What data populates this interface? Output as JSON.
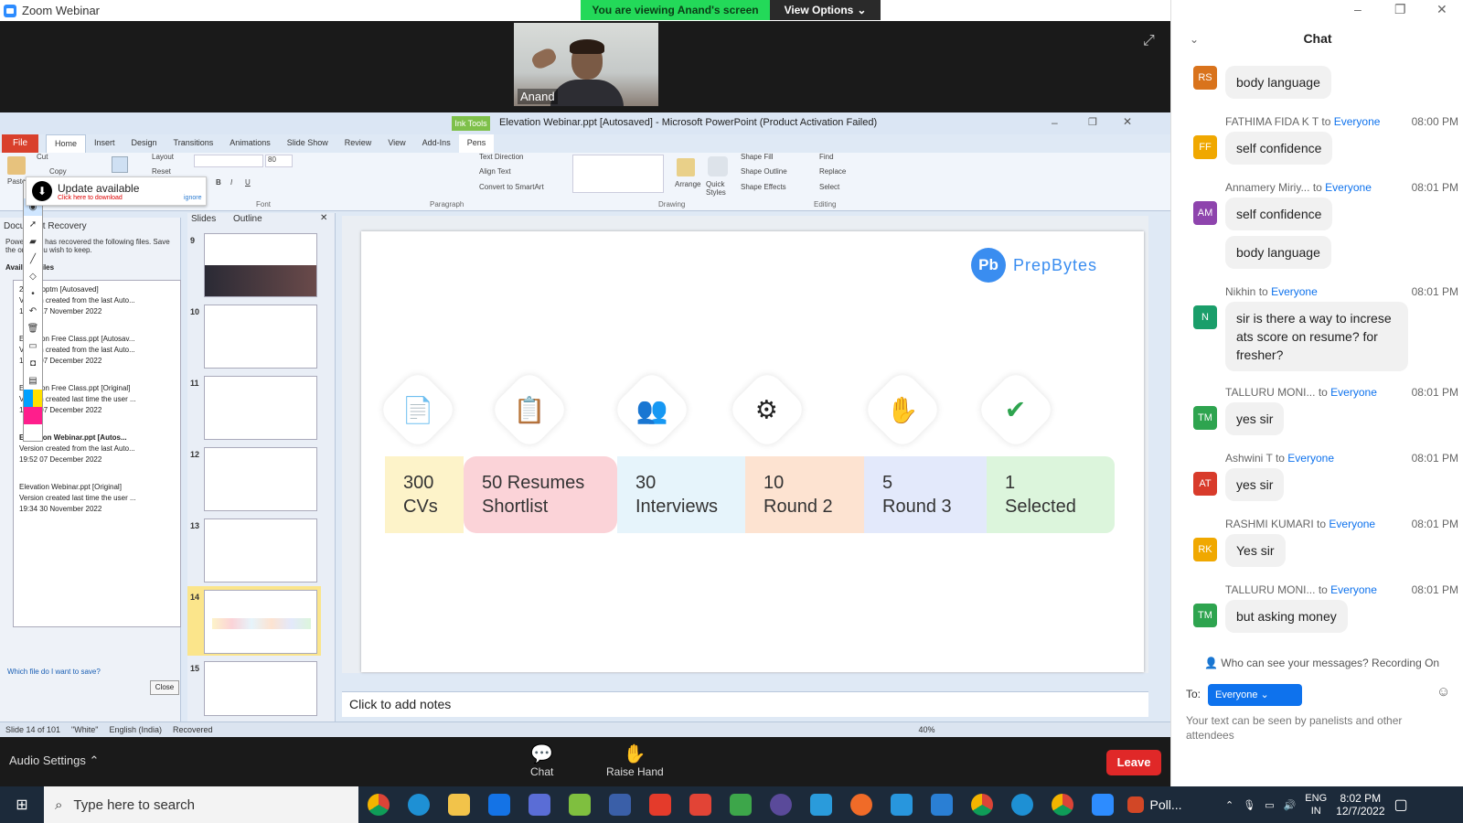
{
  "zoom": {
    "window_title": "Zoom Webinar",
    "viewing_banner": "You are viewing Anand's screen",
    "view_options": "View Options",
    "video_name": "Anand"
  },
  "ppt": {
    "title": "Elevation Webinar.ppt [Autosaved] - Microsoft PowerPoint (Product Activation Failed)",
    "ink_tools": "Ink Tools",
    "pens": "Pens",
    "file_tab": "File",
    "tabs": [
      "Home",
      "Insert",
      "Design",
      "Transitions",
      "Animations",
      "Slide Show",
      "Review",
      "View",
      "Add-Ins"
    ],
    "ribbon": {
      "cut": "Cut",
      "copy": "Copy",
      "paste": "Paste",
      "layout": "Layout",
      "reset": "Reset",
      "font": "Font",
      "paragraph": "Paragraph",
      "drawing": "Drawing",
      "editing": "Editing",
      "text_direction": "Text Direction",
      "align_text": "Align Text",
      "convert_smartart": "Convert to SmartArt",
      "arrange": "Arrange",
      "quick_styles": "Quick Styles",
      "shape_fill": "Shape Fill",
      "shape_outline": "Shape Outline",
      "shape_effects": "Shape Effects",
      "find": "Find",
      "replace": "Replace",
      "select": "Select",
      "font_size": "80"
    },
    "update": {
      "title": "Update available",
      "sub": "Click here to download",
      "ignore": "ignore"
    },
    "recovery": {
      "header": "Document Recovery",
      "desc": "PowerPoint has recovered the following files. Save the ones you wish to keep.",
      "available": "Available files",
      "items": [
        {
          "name": "29433.pptm  [Autosaved]",
          "line1": "Version created from the last Auto...",
          "line2": "19:59 17 November 2022"
        },
        {
          "name": "Elevation Free Class.ppt  [Autosav...",
          "line1": "Version created from the last Auto...",
          "line2": "19:23 07 December 2022"
        },
        {
          "name": "Elevation Free Class.ppt  [Original]",
          "line1": "Version created last time the user ...",
          "line2": "19:20 07 December 2022"
        },
        {
          "name": "Elevation Webinar.ppt  [Autos...",
          "line1": "Version created from the last Auto...",
          "line2": "19:52 07 December 2022"
        },
        {
          "name": "Elevation Webinar.ppt  [Original]",
          "line1": "Version created last time the user ...",
          "line2": "19:34 30 November 2022"
        }
      ],
      "which": "Which file do I want to save?",
      "close": "Close"
    },
    "slides_panel": {
      "tab_slides": "Slides",
      "tab_outline": "Outline",
      "numbers": [
        "9",
        "10",
        "11",
        "12",
        "13",
        "14",
        "15"
      ]
    },
    "slide": {
      "brand": "PrepBytes",
      "logo_letters": "Pb",
      "stages": [
        {
          "num": "300",
          "label": "CVs",
          "color": "#fdf3c9"
        },
        {
          "num": "50 Resumes",
          "label": "Shortlist",
          "color": "#fbd3d8"
        },
        {
          "num": "30",
          "label": "Interviews",
          "color": "#e6f4fb"
        },
        {
          "num": "10",
          "label": "Round 2",
          "color": "#fde3d1"
        },
        {
          "num": "5",
          "label": "Round 3",
          "color": "#e3e9fb"
        },
        {
          "num": "1",
          "label": "Selected",
          "color": "#dcf5dc"
        }
      ]
    },
    "notes_placeholder": "Click to add notes",
    "status": {
      "slide": "Slide 14 of 101",
      "theme": "\"White\"",
      "lang": "English (India)",
      "recovered": "Recovered",
      "zoom": "40%"
    }
  },
  "bottom": {
    "audio": "Audio Settings",
    "chat": "Chat",
    "raise": "Raise Hand",
    "leave": "Leave"
  },
  "chat": {
    "title": "Chat",
    "messages": [
      {
        "initials": "RS",
        "color": "#d9731c",
        "name": "",
        "to": "",
        "time": "",
        "text": "body language"
      },
      {
        "initials": "FF",
        "color": "#f0a800",
        "name": "FATHIMA FIDA K T",
        "to": "Everyone",
        "time": "08:00 PM",
        "text": "self confidence"
      },
      {
        "initials": "AM",
        "color": "#8e44ad",
        "name": "Annamery Miriy...",
        "to": "Everyone",
        "time": "08:01 PM",
        "text": "self confidence",
        "text2": "body language"
      },
      {
        "initials": "N",
        "color": "#1a9e6a",
        "name": "Nikhin",
        "to": "Everyone",
        "time": "08:01 PM",
        "text": "sir is there a way to increse ats score on resume? for fresher?"
      },
      {
        "initials": "TM",
        "color": "#2ea44f",
        "name": "TALLURU MONI...",
        "to": "Everyone",
        "time": "08:01 PM",
        "text": "yes sir"
      },
      {
        "initials": "AT",
        "color": "#d83b2b",
        "name": "Ashwini T",
        "to": "Everyone",
        "time": "08:01 PM",
        "text": "yes sir"
      },
      {
        "initials": "RK",
        "color": "#f0a800",
        "name": "RASHMI KUMARI",
        "to": "Everyone",
        "time": "08:01 PM",
        "text": "Yes sir"
      },
      {
        "initials": "TM",
        "color": "#2ea44f",
        "name": "TALLURU MONI...",
        "to": "Everyone",
        "time": "08:01 PM",
        "text": "but asking money"
      }
    ],
    "to_word": "to",
    "who": "Who can see your messages? Recording On",
    "to_label": "To:",
    "everyone": "Everyone",
    "hint": "Your text can be seen by panelists and other attendees"
  },
  "taskbar": {
    "search": "Type here to search",
    "poll": "Poll...",
    "lang1": "ENG",
    "lang2": "IN",
    "time": "8:02 PM",
    "date": "12/7/2022"
  }
}
